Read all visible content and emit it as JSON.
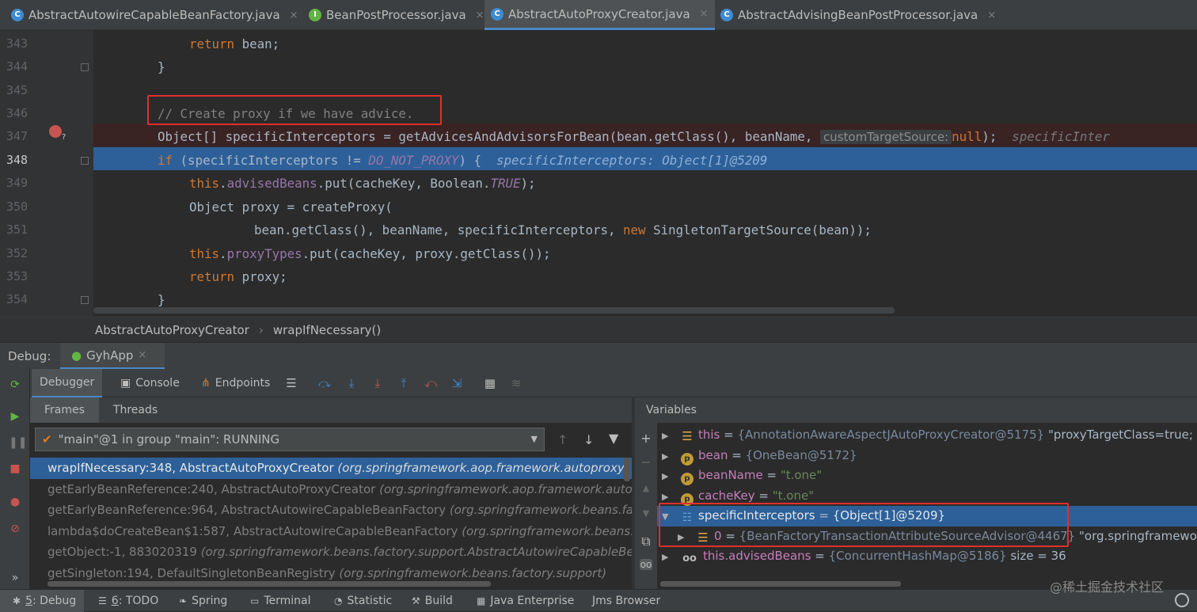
{
  "tabs": [
    {
      "label": "AbstractAutowireCapableBeanFactory.java",
      "icon": "C",
      "active": false
    },
    {
      "label": "BeanPostProcessor.java",
      "icon": "I",
      "active": false
    },
    {
      "label": "AbstractAutoProxyCreator.java",
      "icon": "C",
      "active": true
    },
    {
      "label": "AbstractAdvisingBeanPostProcessor.java",
      "icon": "C",
      "active": false
    }
  ],
  "tab_close": "×",
  "lines": [
    "343",
    "344",
    "345",
    "346",
    "347",
    "348",
    "349",
    "350",
    "351",
    "352",
    "353",
    "354"
  ],
  "code": {
    "l343": {
      "kw": "return",
      "rest": " bean;"
    },
    "l344": "}",
    "l346": "// Create proxy if we have advice.",
    "l347": {
      "pre": "Object[] specificInterceptors = getAdvicesAndAdvisorsForBean(bean.getClass(), beanName, ",
      "inlay": "customTargetSource:",
      "kwnull": "null",
      "post": ");  ",
      "hint": "specificInter"
    },
    "l348": {
      "kw": "if",
      "pre": " (specificInterceptors != ",
      "stat": "DO_NOT_PROXY",
      "post": ") {  ",
      "hint": "specificInterceptors: Object[1]@5209"
    },
    "l349": {
      "kw": "this",
      "dot": ".",
      "field": "advisedBeans",
      "mid": ".put(cacheKey, Boolean.",
      "stat": "TRUE",
      "post": ");"
    },
    "l350": "Object proxy = createProxy(",
    "l351": {
      "pre": "bean.getClass(), beanName, specificInterceptors, ",
      "kw": "new",
      "post": " SingletonTargetSource(bean));"
    },
    "l352": {
      "kw": "this",
      "dot": ".",
      "field": "proxyTypes",
      "post": ".put(cacheKey, proxy.getClass());"
    },
    "l353": {
      "kw": "return",
      "rest": " proxy;"
    },
    "l354": "}"
  },
  "breadcrumb": [
    "AbstractAutoProxyCreator",
    "wrapIfNecessary()"
  ],
  "breadcrumb_sep": "›",
  "debug": {
    "label": "Debug:",
    "session": "GyhApp",
    "session_close": "×"
  },
  "toolbar_tabs": [
    "Debugger",
    "Console",
    "Endpoints"
  ],
  "frames_tabs": [
    "Frames",
    "Threads"
  ],
  "thread_selector": "\"main\"@1 in group \"main\": RUNNING",
  "frames": [
    {
      "method": "wrapIfNecessary:348, AbstractAutoProxyCreator",
      "pkg": "(org.springframework.aop.framework.autoproxy)"
    },
    {
      "method": "getEarlyBeanReference:240, AbstractAutoProxyCreator",
      "pkg": "(org.springframework.aop.framework.autopro"
    },
    {
      "method": "getEarlyBeanReference:964, AbstractAutowireCapableBeanFactory",
      "pkg": "(org.springframework.beans.facto"
    },
    {
      "method": "lambda$doCreateBean$1:587, AbstractAutowireCapableBeanFactory",
      "pkg": "(org.springframework.beans.fac"
    },
    {
      "method": "getObject:-1, 883020319",
      "pkg": "(org.springframework.beans.factory.support.AbstractAutowireCapableBear"
    },
    {
      "method": "getSingleton:194, DefaultSingletonBeanRegistry",
      "pkg": "(org.springframework.beans.factory.support)"
    }
  ],
  "variables_title": "Variables",
  "variables": [
    {
      "name": "this",
      "eq": " = ",
      "val": "{AnnotationAwareAspectJAutoProxyCreator@5175}",
      "tail": " \"proxyTargetClass=true; op"
    },
    {
      "name": "bean",
      "eq": " = ",
      "val": "{OneBean@5172}",
      "tail": ""
    },
    {
      "name": "beanName",
      "eq": " = ",
      "str": "\"t.one\"",
      "tail": ""
    },
    {
      "name": "cacheKey",
      "eq": " = ",
      "str": "\"t.one\"",
      "tail": ""
    },
    {
      "name": "specificInterceptors",
      "eq": " = ",
      "val": "{Object[1]@5209}",
      "tail": ""
    },
    {
      "name": "0",
      "eq": " = ",
      "val": "{BeanFactoryTransactionAttributeSourceAdvisor@4467}",
      "tail": " \"org.springframework."
    },
    {
      "name": "this.advisedBeans",
      "eq": " = ",
      "val": "{ConcurrentHashMap@5186}",
      "tail": "  size = 36"
    }
  ],
  "status": [
    {
      "num": "5",
      "label": ": Debug"
    },
    {
      "num": "6",
      "label": ": TODO"
    },
    {
      "num": "",
      "label": "Spring"
    },
    {
      "num": "",
      "label": "Terminal"
    },
    {
      "num": "",
      "label": "Statistic"
    },
    {
      "num": "",
      "label": "Build"
    },
    {
      "num": "",
      "label": "Java Enterprise"
    },
    {
      "num": "",
      "label": "Jms Browser"
    }
  ],
  "watermark": "@稀土掘金技术社区",
  "colors": {
    "accent": "#4a88c7",
    "selection": "#2d6099",
    "annotation": "#e0302c"
  }
}
